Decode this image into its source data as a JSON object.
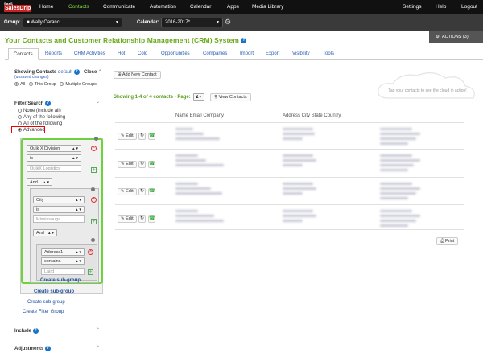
{
  "logo": {
    "line1": "SaaS",
    "line2": "SalesDrip"
  },
  "topnav": {
    "items": [
      "Home",
      "Contacts",
      "Communicate",
      "Automation",
      "Calendar",
      "Apps",
      "Media Library"
    ],
    "right": [
      "Settings",
      "Help",
      "Logout"
    ],
    "active": "Contacts"
  },
  "toolbar": {
    "group_label": "Group:",
    "group_value": "Wally Caranci",
    "calendar_label": "Calendar:",
    "calendar_value": "2016-2017*"
  },
  "page_title": "Your Contacts and Customer Relationship Management (CRM) System",
  "actions_label": "ACTIONS (3)",
  "tabs": [
    "Contacts",
    "Reports",
    "CRM Activities",
    "Hot",
    "Cold",
    "Opportunities",
    "Companies",
    "Import",
    "Export",
    "Visibility",
    "Tools"
  ],
  "sidebar": {
    "showing_title": "Showing Contacts",
    "showing_default": "default",
    "close_label": "Close",
    "unsaved": "(unsaved changes)",
    "scope_all": "All",
    "scope_this_group": "This Group",
    "scope_multiple": "Multiple Groups",
    "filter_title": "Filter/Search",
    "filter_options": [
      "None (include all)",
      "Any of the following",
      "All of the following",
      "Advanced"
    ],
    "filter_selected": "Advanced",
    "rule1": {
      "field": "Quik X Division",
      "op": "is",
      "value": "QuikX Logistics"
    },
    "and1": "And",
    "rule2": {
      "field": "City",
      "op": "is",
      "value": "Mississauga"
    },
    "and2": "And",
    "rule3": {
      "field": "Address1",
      "op": "contains",
      "value": "Laird"
    },
    "create_sub_group": "Create sub-group",
    "create_filter_group": "Create Filter Group",
    "include_title": "Include",
    "adjustments_title": "Adjustments"
  },
  "main": {
    "add_contact": "Add New Contact",
    "showing_text": "Showing 1-4 of 4 contacts - Page:",
    "page_value": "1",
    "view_contacts": "View Contacts",
    "cloud_hint": "Tag your contacts to see the cloud in action!",
    "col_name": "Name Email Company",
    "col_address": "Address City State Country",
    "edit_label": "Edit",
    "print_label": "Print"
  },
  "colors": {
    "accent": "#7ed13c",
    "title": "#6aaa1c",
    "link": "#2a5db0",
    "highlight_box": "#e00000",
    "green_box": "#6cd33c"
  },
  "icons": [
    "gear-icon",
    "help-icon",
    "plus-icon",
    "refresh-icon",
    "print-icon",
    "remove-icon"
  ]
}
